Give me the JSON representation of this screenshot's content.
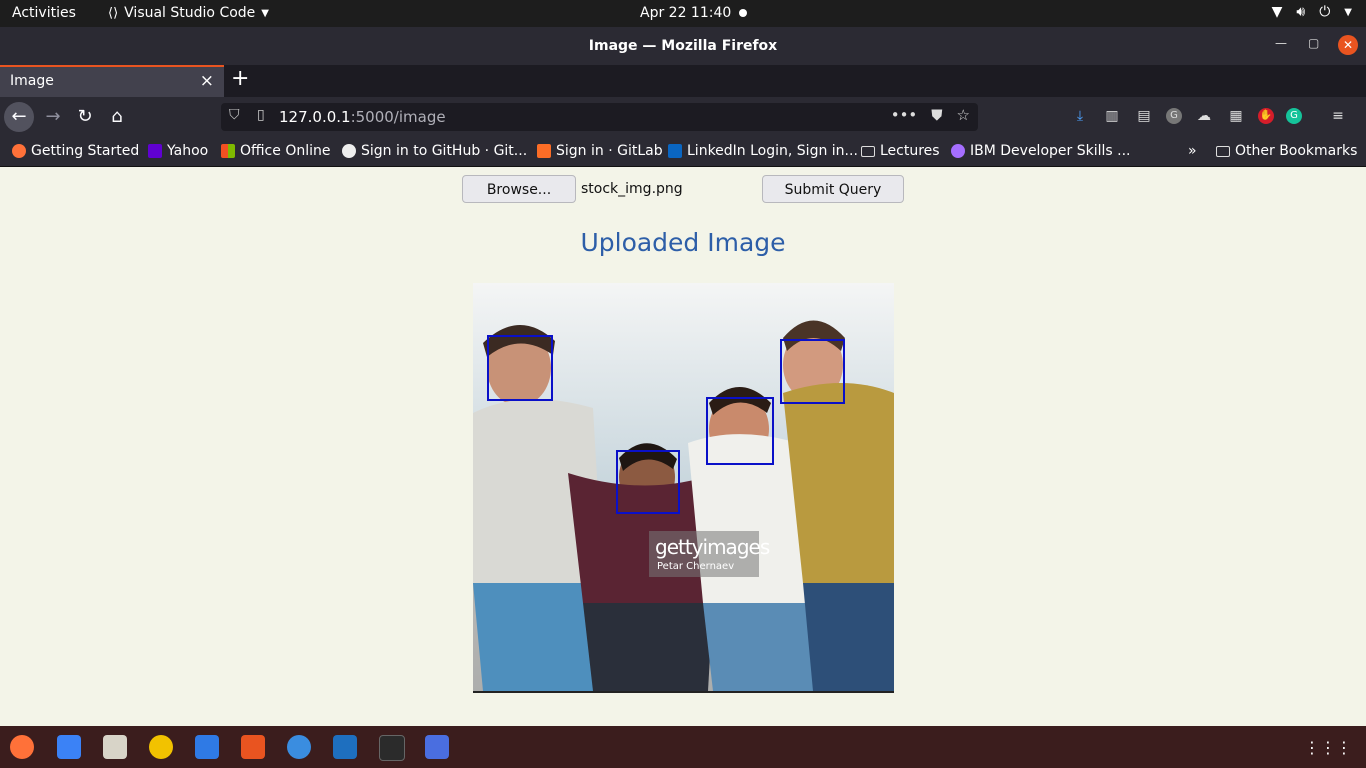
{
  "system_bar": {
    "activities": "Activities",
    "app_name": "Visual Studio Code",
    "clock": "Apr 22  11:40"
  },
  "window": {
    "title": "Image — Mozilla Firefox"
  },
  "tabs": [
    {
      "label": "Image"
    }
  ],
  "url": {
    "host": "127.0.0.1",
    "path": ":5000/image"
  },
  "bookmarks": [
    {
      "label": "Getting Started",
      "icon": "firefox-icon"
    },
    {
      "label": "Yahoo",
      "icon": "yahoo-icon"
    },
    {
      "label": "Office Online",
      "icon": "office-icon"
    },
    {
      "label": "Sign in to GitHub · Git...",
      "icon": "github-icon"
    },
    {
      "label": "Sign in · GitLab",
      "icon": "gitlab-icon"
    },
    {
      "label": "LinkedIn Login, Sign in...",
      "icon": "linkedin-icon"
    },
    {
      "label": "Lectures",
      "icon": "folder-icon"
    },
    {
      "label": "IBM Developer Skills ...",
      "icon": "ibm-icon"
    },
    {
      "label": "Other Bookmarks",
      "icon": "folder-icon"
    }
  ],
  "page": {
    "browse_label": "Browse...",
    "file_name": "stock_img.png",
    "submit_label": "Submit Query",
    "heading": "Uploaded Image",
    "watermark_brand": "gettyimages",
    "watermark_credit": "Petar Chernaev",
    "detected_faces": 4
  },
  "colors": {
    "heading": "#2d5ea8",
    "face_box": "#0a10c8",
    "page_bg": "#f3f4e8",
    "accent": "#e95420"
  }
}
